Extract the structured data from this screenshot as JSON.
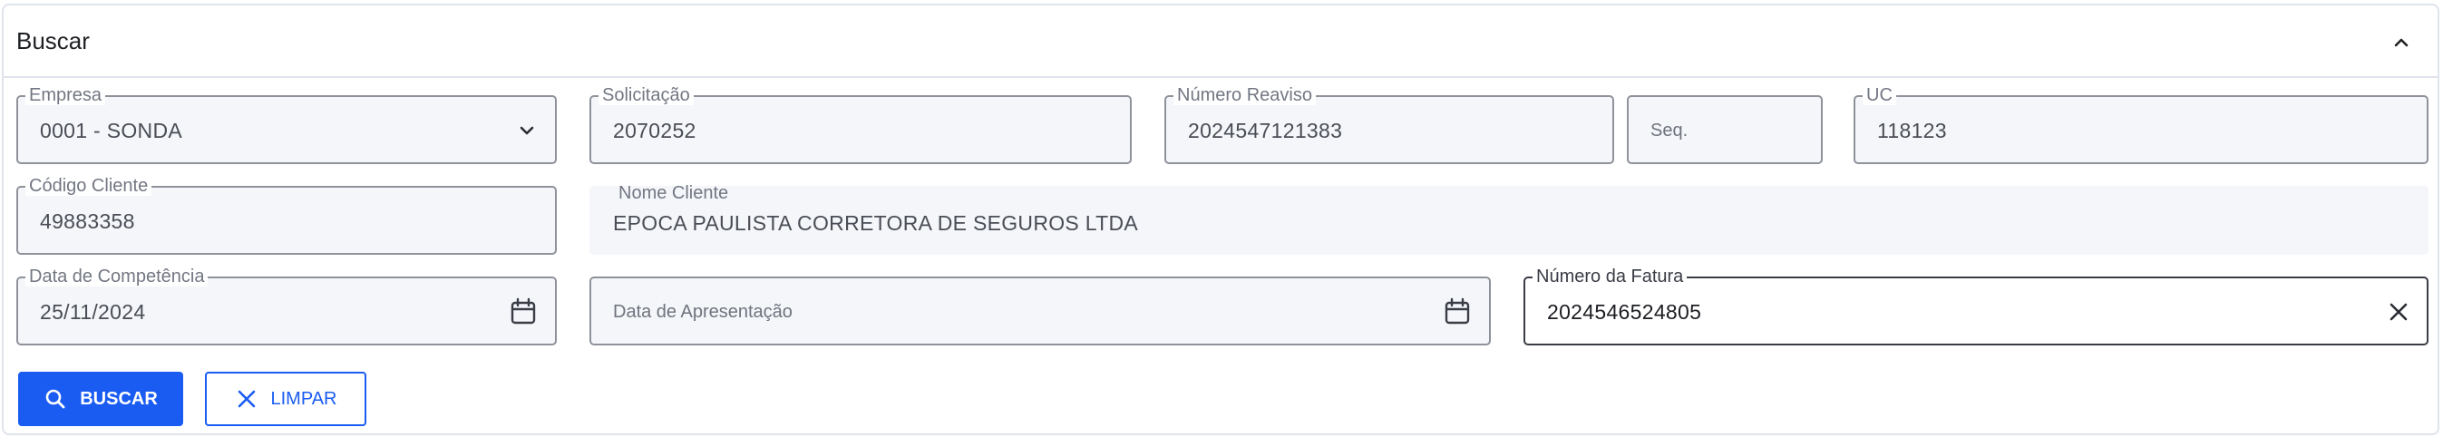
{
  "panel": {
    "title": "Buscar"
  },
  "fields": {
    "empresa": {
      "label": "Empresa",
      "value": "0001 - SONDA"
    },
    "solicitacao": {
      "label": "Solicitação",
      "value": "2070252"
    },
    "numero_reaviso": {
      "label": "Número Reaviso",
      "value": "2024547121383"
    },
    "seq": {
      "placeholder": "Seq."
    },
    "uc": {
      "label": "UC",
      "value": "118123"
    },
    "codigo_cliente": {
      "label": "Código Cliente",
      "value": "49883358"
    },
    "nome_cliente": {
      "label": "Nome Cliente",
      "value": "EPOCA PAULISTA CORRETORA DE SEGUROS LTDA"
    },
    "data_competencia": {
      "label": "Data de Competência",
      "value": "25/11/2024"
    },
    "data_apresentacao": {
      "placeholder": "Data de Apresentação"
    },
    "numero_fatura": {
      "label": "Número da Fatura",
      "value": "2024546524805"
    }
  },
  "buttons": {
    "search": "BUSCAR",
    "clear": "LIMPAR"
  },
  "colors": {
    "primary": "#1a5cf2",
    "border": "#8f929b",
    "field_bg": "#f4f6fa"
  },
  "icons": [
    "chevron-up-icon",
    "chevron-down-icon",
    "calendar-icon",
    "close-icon",
    "search-icon"
  ]
}
